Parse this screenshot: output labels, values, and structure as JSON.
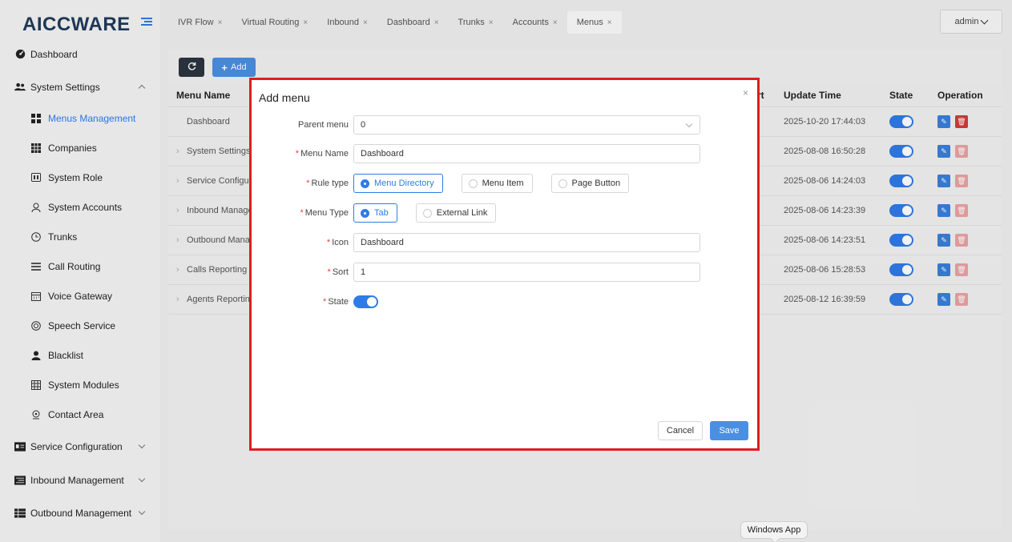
{
  "logo": {
    "part1": "AICC",
    "part2": "WARE"
  },
  "sidebar": {
    "items": [
      {
        "label": "Dashboard",
        "icon": "dashboard-icon"
      },
      {
        "label": "System Settings",
        "icon": "users-icon"
      },
      {
        "label": "Menus Management",
        "icon": "grid-icon"
      },
      {
        "label": "Companies",
        "icon": "table-icon"
      },
      {
        "label": "System Role",
        "icon": "card-icon"
      },
      {
        "label": "System Accounts",
        "icon": "user-icon"
      },
      {
        "label": "Trunks",
        "icon": "clock-icon"
      },
      {
        "label": "Call Routing",
        "icon": "list-icon"
      },
      {
        "label": "Voice Gateway",
        "icon": "calendar-icon"
      },
      {
        "label": "Speech Service",
        "icon": "disc-icon"
      },
      {
        "label": "Blacklist",
        "icon": "person-icon"
      },
      {
        "label": "System Modules",
        "icon": "modules-icon"
      },
      {
        "label": "Contact Area",
        "icon": "location-icon"
      },
      {
        "label": "Service Configuration",
        "icon": "id-card-icon"
      },
      {
        "label": "Inbound Management",
        "icon": "inbound-icon"
      },
      {
        "label": "Outbound Management",
        "icon": "outbound-icon"
      }
    ]
  },
  "tabs": [
    {
      "label": "IVR Flow"
    },
    {
      "label": "Virtual Routing"
    },
    {
      "label": "Inbound"
    },
    {
      "label": "Dashboard"
    },
    {
      "label": "Trunks"
    },
    {
      "label": "Accounts"
    },
    {
      "label": "Menus"
    }
  ],
  "tab_close": "×",
  "user": {
    "name": "admin"
  },
  "toolbar": {
    "add_label": "Add",
    "add_icon": "plus-icon",
    "refresh_icon": "refresh-icon"
  },
  "table": {
    "headers": {
      "name": "Menu Name",
      "sort": "rt",
      "update_time": "Update Time",
      "state": "State",
      "operation": "Operation"
    },
    "rows": [
      {
        "name": "Dashboard",
        "time": "2025-10-20 17:44:03"
      },
      {
        "name": "System Settings",
        "time": "2025-08-08 16:50:28"
      },
      {
        "name": "Service Configur",
        "time": "2025-08-06 14:24:03"
      },
      {
        "name": "Inbound Manage",
        "time": "2025-08-06 14:23:39"
      },
      {
        "name": "Outbound Mana",
        "time": "2025-08-06 14:23:51"
      },
      {
        "name": "Calls Reporting",
        "time": "2025-08-06 15:28:53"
      },
      {
        "name": "Agents Reportin",
        "time": "2025-08-12 16:39:59"
      }
    ]
  },
  "modal": {
    "title": "Add menu",
    "close": "×",
    "fields": {
      "parent_menu": {
        "label": "Parent menu",
        "value": "0"
      },
      "menu_name": {
        "label": "Menu Name",
        "value": "Dashboard"
      },
      "rule_type": {
        "label": "Rule type",
        "options": [
          "Menu Directory",
          "Menu Item",
          "Page Button"
        ],
        "selected": "Menu Directory"
      },
      "menu_type": {
        "label": "Menu Type",
        "options": [
          "Tab",
          "External Link"
        ],
        "selected": "Tab"
      },
      "icon": {
        "label": "Icon",
        "value": "Dashboard"
      },
      "sort": {
        "label": "Sort",
        "value": "1"
      },
      "state": {
        "label": "State",
        "on": true
      }
    },
    "required_mark": "*",
    "cancel_label": "Cancel",
    "save_label": "Save"
  },
  "tooltip": {
    "text": "Windows App"
  },
  "colors": {
    "accent": "#2f7be8",
    "danger": "#d23a3a",
    "highlight_border": "#e01d1d",
    "sidebar_bg": "#f4f4f4"
  }
}
